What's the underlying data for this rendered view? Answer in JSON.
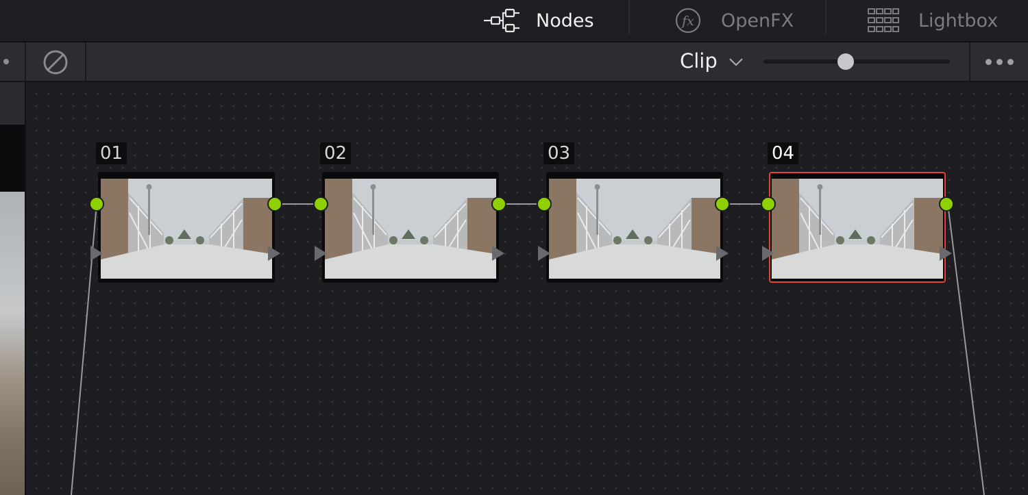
{
  "top_tabs": [
    {
      "label": "Nodes",
      "icon": "nodes-icon",
      "active": true
    },
    {
      "label": "OpenFX",
      "icon": "fx-icon",
      "active": false
    },
    {
      "label": "Lightbox",
      "icon": "lightbox-grid-icon",
      "active": false
    }
  ],
  "toolbar": {
    "mode_label": "Clip",
    "mode_dropdown_icon": "chevron-down-icon",
    "bypass_icon": "bypass-icon",
    "more_icon": "more-options-icon",
    "zoom_level": 0.44
  },
  "nodes": [
    {
      "number": "01",
      "selected": false
    },
    {
      "number": "02",
      "selected": false
    },
    {
      "number": "03",
      "selected": false
    },
    {
      "number": "04",
      "selected": true
    }
  ],
  "colors": {
    "port_green": "#8fd100",
    "selection_red": "#e2442f",
    "background": "#1e1e22"
  }
}
